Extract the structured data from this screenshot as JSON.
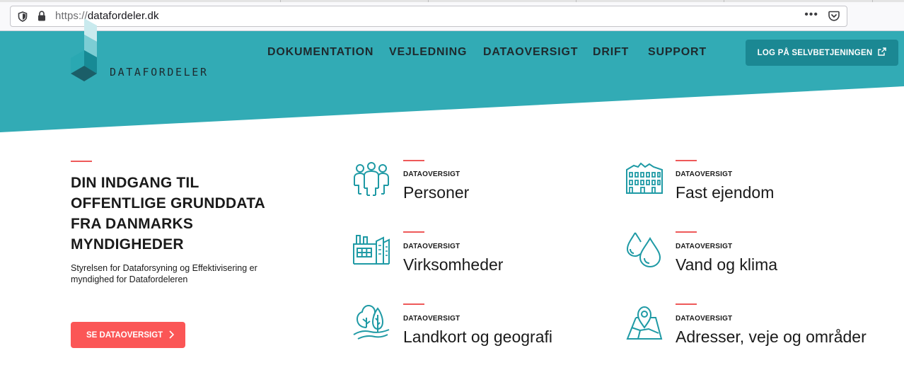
{
  "browser": {
    "url_scheme": "https://",
    "url_host": "datafordeler.dk",
    "menu_glyph": "•••",
    "icons": [
      "shield-icon",
      "lock-icon",
      "pocket-icon"
    ]
  },
  "brand": {
    "name": "DATAFORDELER",
    "color_teal": "#32abb5",
    "color_dark_teal": "#1b8893",
    "color_red": "#fb5656"
  },
  "nav": {
    "items": [
      "DOKUMENTATION",
      "VEJLEDNING",
      "DATAOVERSIGT",
      "DRIFT",
      "SUPPORT"
    ],
    "login_label": "LOG PÅ SELVBETJENINGEN"
  },
  "intro": {
    "title": "DIN INDGANG TIL OFFENTLIGE GRUNDDATA FRA DANMARKS MYNDIGHEDER",
    "subtitle": "Styrelsen for Dataforsyning og Effektivisering er myndighed for Datafordeleren",
    "cta_label": "SE DATAOVERSIGT"
  },
  "categories": [
    {
      "kicker": "DATAOVERSIGT",
      "name": "Personer",
      "icon": "people-icon"
    },
    {
      "kicker": "DATAOVERSIGT",
      "name": "Fast ejendom",
      "icon": "building-icon"
    },
    {
      "kicker": "DATAOVERSIGT",
      "name": "Virksomheder",
      "icon": "factory-icon"
    },
    {
      "kicker": "DATAOVERSIGT",
      "name": "Vand og klima",
      "icon": "water-drops-icon"
    },
    {
      "kicker": "DATAOVERSIGT",
      "name": "Landkort og geografi",
      "icon": "trees-icon"
    },
    {
      "kicker": "DATAOVERSIGT",
      "name": "Adresser, veje og områder",
      "icon": "map-pin-icon"
    }
  ]
}
